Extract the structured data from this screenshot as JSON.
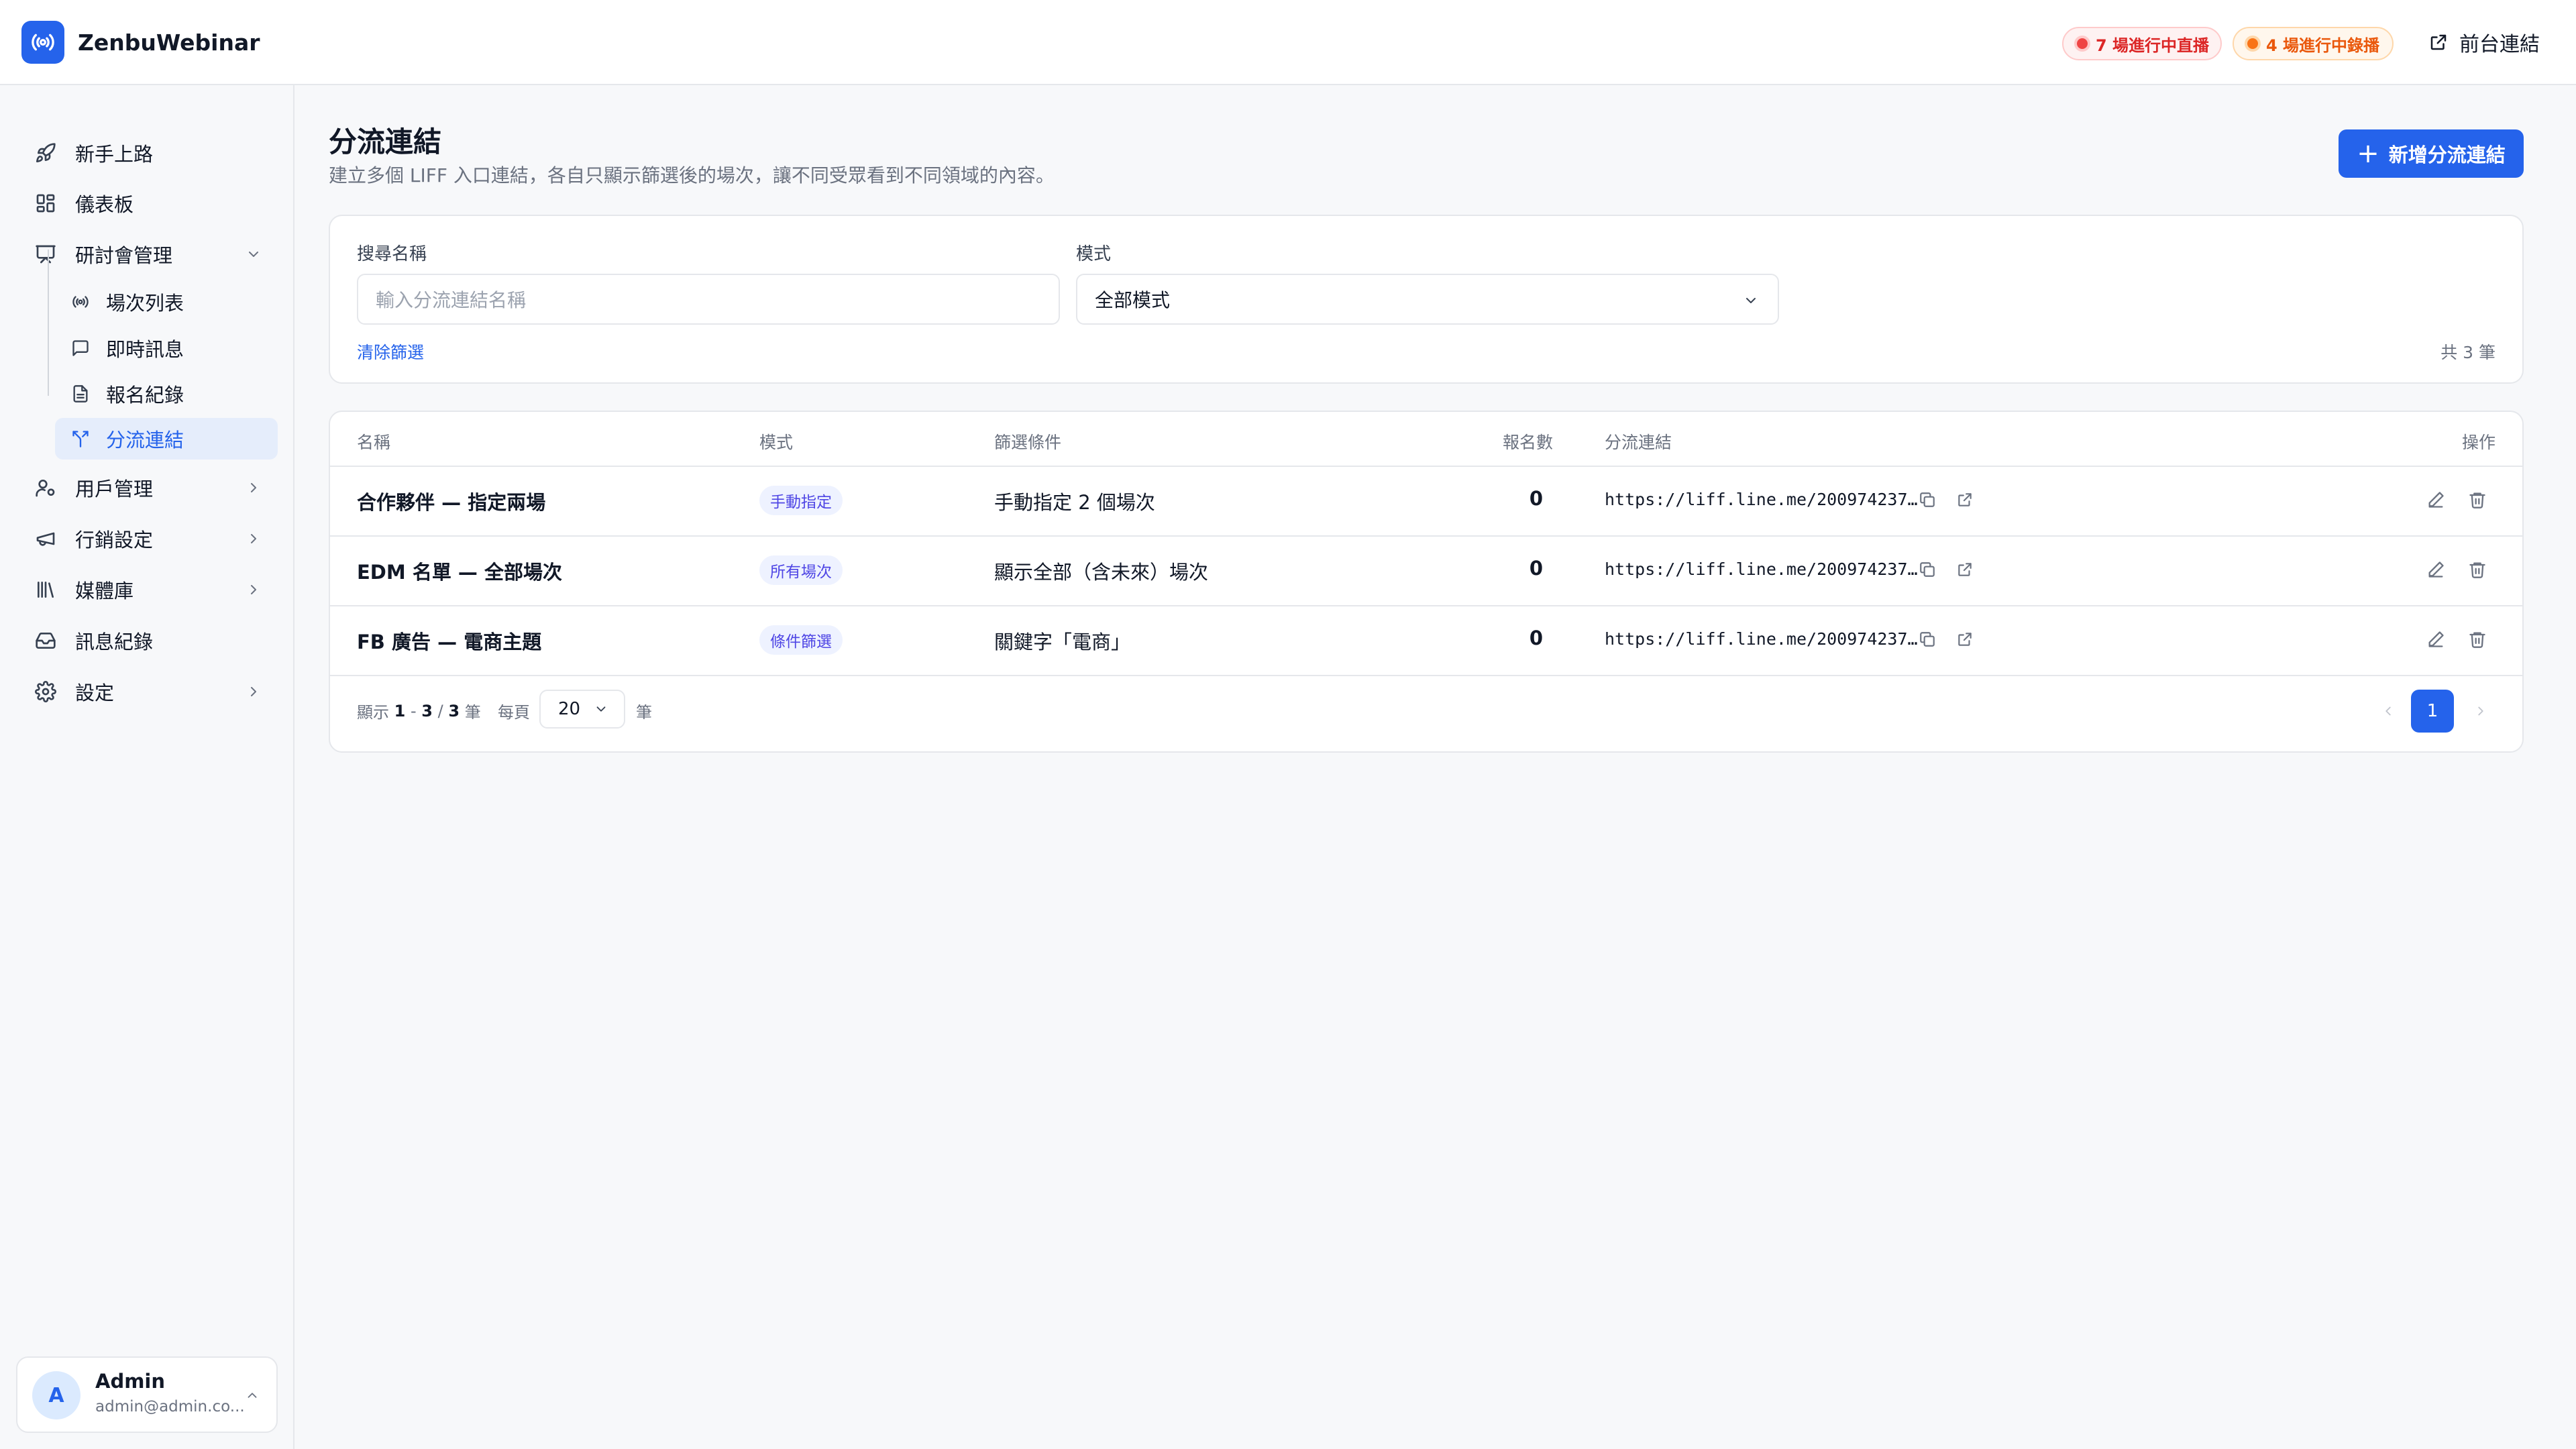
{
  "app": {
    "name": "ZenbuWebinar",
    "live_badge": "7 場進行中直播",
    "rec_badge": "4 場進行中錄播",
    "front_link": "前台連結",
    "colors": {
      "accent": "#2563eb",
      "live": "#dc2626",
      "recording": "#ea580c"
    }
  },
  "sidebar": {
    "items": [
      {
        "label": "新手上路",
        "icon": "rocket-icon"
      },
      {
        "label": "儀表板",
        "icon": "dashboard-icon"
      },
      {
        "label": "研討會管理",
        "icon": "presentation-icon"
      },
      {
        "label": "用戶管理",
        "icon": "users-icon"
      },
      {
        "label": "行銷設定",
        "icon": "megaphone-icon"
      },
      {
        "label": "媒體庫",
        "icon": "library-icon"
      },
      {
        "label": "訊息紀錄",
        "icon": "inbox-icon"
      },
      {
        "label": "設定",
        "icon": "gear-icon"
      }
    ],
    "sub_items": [
      {
        "label": "場次列表",
        "icon": "broadcast-icon"
      },
      {
        "label": "即時訊息",
        "icon": "chat-icon"
      },
      {
        "label": "報名紀錄",
        "icon": "document-icon"
      },
      {
        "label": "分流連結",
        "icon": "split-icon",
        "active": true
      }
    ],
    "user": {
      "initial": "A",
      "name": "Admin",
      "email": "admin@admin.co..."
    }
  },
  "page": {
    "title": "分流連結",
    "description": "建立多個 LIFF 入口連結，各自只顯示篩選後的場次，讓不同受眾看到不同領域的內容。",
    "add_button": "新增分流連結"
  },
  "filters": {
    "search_label": "搜尋名稱",
    "search_placeholder": "輸入分流連結名稱",
    "mode_label": "模式",
    "mode_value": "全部模式",
    "clear": "清除篩選",
    "total": "共 3 筆"
  },
  "table": {
    "columns": [
      "名稱",
      "模式",
      "篩選條件",
      "報名數",
      "分流連結",
      "操作"
    ],
    "rows": [
      {
        "name": "合作夥伴 — 指定兩場",
        "mode": "手動指定",
        "filter": "手動指定 2 個場次",
        "count": "0",
        "link": "https://liff.line.me/200974237…"
      },
      {
        "name": "EDM 名單 — 全部場次",
        "mode": "所有場次",
        "filter": "顯示全部（含未來）場次",
        "count": "0",
        "link": "https://liff.line.me/200974237…"
      },
      {
        "name": "FB 廣告 — 電商主題",
        "mode": "條件篩選",
        "filter": "關鍵字「電商」",
        "count": "0",
        "link": "https://liff.line.me/200974237…"
      }
    ]
  },
  "pagination": {
    "showing_prefix": "顯示",
    "range_start": "1",
    "range_sep": "-",
    "range_end": "3",
    "slash": "/",
    "total": "3",
    "unit": "筆",
    "per_page_label": "每頁",
    "per_page": "20",
    "per_page_unit": "筆",
    "current_page": "1"
  }
}
